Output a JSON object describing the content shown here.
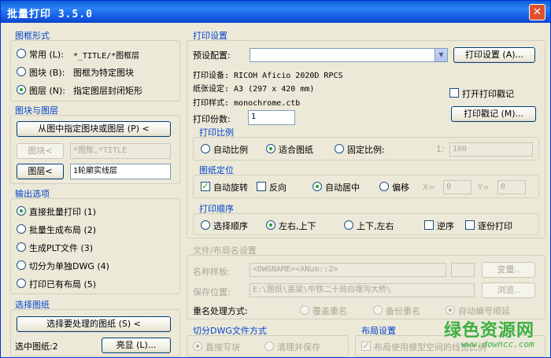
{
  "title": "批量打印  3.5.0",
  "close_glyph": "✕",
  "frame_shape": {
    "label": "图框形式",
    "options": [
      {
        "key": "常用 (L):",
        "desc": "*_TITLE/*图框层",
        "checked": false
      },
      {
        "key": "图块 (B):",
        "desc": "图框为特定图块",
        "checked": false
      },
      {
        "key": "图层 (N):",
        "desc": "指定图层封闭矩形",
        "checked": true
      }
    ]
  },
  "block_layer": {
    "label": "图块与图层",
    "pick_btn": "从图中指定图块或图层 (P) <",
    "block_btn": "图块<",
    "block_value": "*图框,*TITLE",
    "layer_btn": "图层<",
    "layer_value": "1轮廓实线层"
  },
  "output": {
    "label": "输出选项",
    "options": [
      {
        "text": "直接批量打印 (1)",
        "checked": true
      },
      {
        "text": "批量生成布局 (2)",
        "checked": false
      },
      {
        "text": "生成PLT文件 (3)",
        "checked": false
      },
      {
        "text": "切分为单独DWG (4)",
        "checked": false
      },
      {
        "text": "打印已有布局 (5)",
        "checked": false
      }
    ]
  },
  "select_drawing": {
    "label": "选择图纸",
    "btn": "选择要处理的图纸 (S) <",
    "count": "选中图纸:2",
    "highlight_btn": "亮显 (L)..."
  },
  "print_settings": {
    "label": "打印设置",
    "preset_label": "预设配置:",
    "preset_value": "",
    "settings_btn": "打印设置 (A)...",
    "device": "打印设备: RICOH Aficio 2020D RPCS",
    "paper": "纸张设定: A3 (297 x 420 mm)",
    "style": "打印样式: monochrome.ctb",
    "copies_label": "打印份数:",
    "copies_value": "1",
    "stamp_check": "打开打印戳记",
    "stamp_btn": "打印戳记 (M)..."
  },
  "scale": {
    "label": "打印比例",
    "auto": "自动比例",
    "fit": "适合图纸",
    "fixed": "固定比例:",
    "ratio_prefix": "1:",
    "ratio_value": "100"
  },
  "position": {
    "label": "图纸定位",
    "rotate": "自动旋转",
    "reverse": "反向",
    "center": "自动居中",
    "offset": "偏移",
    "x_label": "X=",
    "x_value": "0",
    "y_label": "Y=",
    "y_value": "0"
  },
  "order": {
    "label": "打印顺序",
    "select": "选择顺序",
    "lr_tb": "左右,上下",
    "tb_lr": "上下,左右",
    "reverse": "逆序",
    "by_copy": "逐份打印"
  },
  "file_name": {
    "label": "文件/布局名设置",
    "sample_label": "名称样板:",
    "sample_value": "<DWGNAME><ANum::2>",
    "var_btn": "变量..",
    "save_label": "保存位置:",
    "save_value": "E:\\图纸\\盖梁\\中铁二十局白堰沟大桥\\",
    "browse_btn": "浏览..",
    "rename_label": "重名处理方式:",
    "rename_opts": [
      "覆盖重名",
      "备份重名",
      "自动编号顺延"
    ]
  },
  "split": {
    "label": "切分DWG文件方式",
    "opt1": "直接写块",
    "opt2": "清理并保存"
  },
  "layout": {
    "label": "布局设置",
    "opt": "布局使用模型空间的线宽比例"
  },
  "watermark": {
    "text": "绿色资源网",
    "url": "www.downcc.com"
  }
}
